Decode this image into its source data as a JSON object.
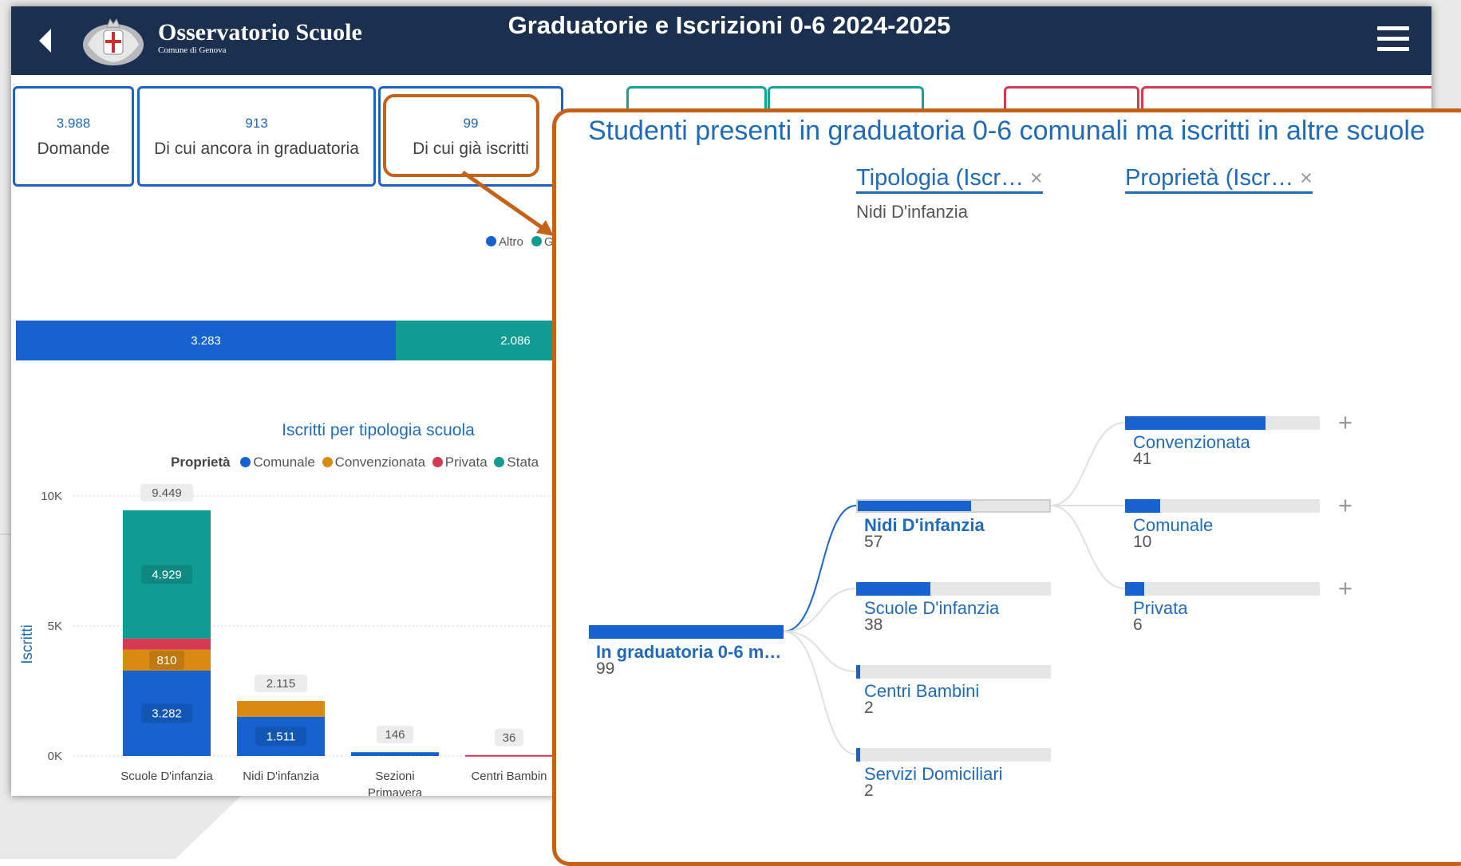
{
  "header": {
    "brand_title": "Osservatorio Scuole",
    "brand_subtitle": "Comune di Genova",
    "page_title": "Graduatorie e Iscrizioni 0-6 2024-2025"
  },
  "kpis": [
    {
      "value": "3.988",
      "label": "Domande"
    },
    {
      "value": "913",
      "label": "Di cui ancora in graduatoria"
    },
    {
      "value": "99",
      "label": "Di cui già iscritti"
    }
  ],
  "top_bar": {
    "legend": [
      "Altro",
      "Gr"
    ],
    "segments": [
      {
        "label": "3.283",
        "color": "#1663d0"
      },
      {
        "label": "2.086",
        "color": "#119c93"
      }
    ]
  },
  "colors": {
    "comunale": "#1663d0",
    "convenzionata": "#d98a12",
    "privata": "#d43a50",
    "statale": "#119c93",
    "header_bg": "#1b2f4f",
    "highlight": "#c5621a"
  },
  "chart_data": {
    "type": "bar",
    "title": "Iscritti per tipologia scuola",
    "legend_title": "Proprietà",
    "legend": [
      "Comunale",
      "Convenzionata",
      "Privata",
      "Stata"
    ],
    "ylabel": "Iscritti",
    "yticks": [
      "10K",
      "5K",
      "0K"
    ],
    "ylim": [
      0,
      10000
    ],
    "categories": [
      "Scuole D'infanzia",
      "Nidi D'infanzia",
      "Sezioni Primavera",
      "Centri Bambin"
    ],
    "series": [
      {
        "name": "Comunale",
        "values": [
          3282,
          1511,
          146,
          0
        ]
      },
      {
        "name": "Convenzionata",
        "values": [
          810,
          604,
          0,
          0
        ]
      },
      {
        "name": "Privata",
        "values": [
          428,
          0,
          0,
          36
        ]
      },
      {
        "name": "Statale",
        "values": [
          4929,
          0,
          0,
          0
        ]
      }
    ],
    "segment_labels": [
      {
        "series": 0,
        "category": 0,
        "text": "3.282"
      },
      {
        "series": 1,
        "category": 0,
        "text": "810"
      },
      {
        "series": 3,
        "category": 0,
        "text": "4.929"
      },
      {
        "series": 0,
        "category": 1,
        "text": "1.511"
      }
    ],
    "totals": [
      "9.449",
      "2.115",
      "146",
      "36"
    ]
  },
  "popup": {
    "title": "Studenti presenti in graduatoria 0-6 comunali ma iscritti in altre scuole",
    "col1_header": "Tipologia (Iscr…",
    "col1_subtitle": "Nidi D'infanzia",
    "col2_header": "Proprietà (Iscr…",
    "close_glyph": "×",
    "plus_glyph": "+",
    "root": {
      "label": "In graduatoria 0-6 m…",
      "value": "99"
    },
    "level1": [
      {
        "label": "Nidi D'infanzia",
        "value": "57",
        "fraction": 0.58
      },
      {
        "label": "Scuole D'infanzia",
        "value": "38",
        "fraction": 0.38
      },
      {
        "label": "Centri Bambini",
        "value": "2",
        "fraction": 0.02
      },
      {
        "label": "Servizi Domiciliari",
        "value": "2",
        "fraction": 0.02
      }
    ],
    "level2": [
      {
        "label": "Convenzionata",
        "value": "41",
        "fraction": 0.72
      },
      {
        "label": "Comunale",
        "value": "10",
        "fraction": 0.18
      },
      {
        "label": "Privata",
        "value": "6",
        "fraction": 0.1
      }
    ]
  }
}
